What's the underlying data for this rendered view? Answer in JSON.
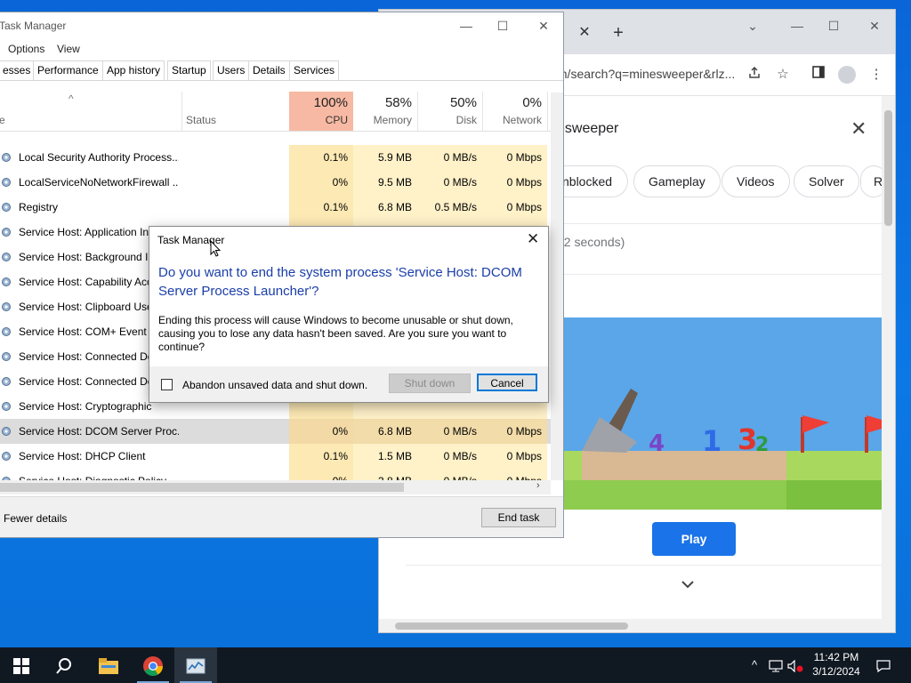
{
  "chrome": {
    "tab_close": "✕",
    "new_tab": "+",
    "window_controls": [
      "⌄",
      "—",
      "☐",
      "✕"
    ],
    "url_text": "/m/search?q=minesweeper&rlz...",
    "search_query": "esweeper",
    "chips": [
      "nblocked",
      "Gameplay",
      "Videos",
      "Solver",
      "R"
    ],
    "result_stats": "32 seconds)",
    "play_label": "Play",
    "expand_icon": "chevron-down-icon",
    "brand_blue": "#1a73e8"
  },
  "task_manager": {
    "title": "Task Manager",
    "menu": [
      "Options",
      "View"
    ],
    "tabs": [
      "esses",
      "Performance",
      "App history",
      "Startup",
      "Users",
      "Details",
      "Services"
    ],
    "columns": {
      "name": "e",
      "status": "Status",
      "cpu_pct": "100%",
      "cpu": "CPU",
      "mem_pct": "58%",
      "mem": "Memory",
      "disk_pct": "50%",
      "disk": "Disk",
      "net_pct": "0%",
      "net": "Network",
      "power_initial": "P"
    },
    "rows": [
      {
        "name": "Local Security Authority Process...",
        "cpu": "0.1%",
        "mem": "5.9 MB",
        "disk": "0 MB/s",
        "net": "0 Mbps"
      },
      {
        "name": "LocalServiceNoNetworkFirewall ...",
        "cpu": "0%",
        "mem": "9.5 MB",
        "disk": "0 MB/s",
        "net": "0 Mbps"
      },
      {
        "name": "Registry",
        "cpu": "0.1%",
        "mem": "6.8 MB",
        "disk": "0.5 MB/s",
        "net": "0 Mbps"
      },
      {
        "name": "Service Host: Application Infor...",
        "cpu": "0%",
        "mem": "0.7 MB",
        "disk": "0 MB/s",
        "net": "0 Mbps"
      },
      {
        "name": "Service Host: Background In",
        "cpu": "",
        "mem": "",
        "disk": "",
        "net": ""
      },
      {
        "name": "Service Host: Capability Acc",
        "cpu": "",
        "mem": "",
        "disk": "",
        "net": ""
      },
      {
        "name": "Service Host: Clipboard User",
        "cpu": "",
        "mem": "",
        "disk": "",
        "net": ""
      },
      {
        "name": "Service Host: COM+ Event S",
        "cpu": "",
        "mem": "",
        "disk": "",
        "net": ""
      },
      {
        "name": "Service Host: Connected De",
        "cpu": "",
        "mem": "",
        "disk": "",
        "net": ""
      },
      {
        "name": "Service Host: Connected De",
        "cpu": "",
        "mem": "",
        "disk": "",
        "net": ""
      },
      {
        "name": "Service Host: Cryptographic",
        "cpu": "",
        "mem": "",
        "disk": "",
        "net": ""
      },
      {
        "name": "Service Host: DCOM Server Proc...",
        "cpu": "0%",
        "mem": "6.8 MB",
        "disk": "0 MB/s",
        "net": "0 Mbps"
      },
      {
        "name": "Service Host: DHCP Client",
        "cpu": "0.1%",
        "mem": "1.5 MB",
        "disk": "0 MB/s",
        "net": "0 Mbps"
      },
      {
        "name": "Service Host: Diagnostic Policy ...",
        "cpu": "0%",
        "mem": "3.8 MB",
        "disk": "0 MB/s",
        "net": "0 Mbps"
      }
    ],
    "fewer_details": "Fewer details",
    "end_task": "End task",
    "cpu_header_color": "#f7b9a3",
    "cpu_cell_color": "#fde9b4",
    "mem_cell_color": "#fff1c8"
  },
  "dialog": {
    "title": "Task Manager",
    "heading": "Do you want to end the system process 'Service Host: DCOM Server Process Launcher'?",
    "body": "Ending this process will cause Windows to become unusable or shut down, causing you to lose any data hasn't been saved. Are you sure you want to continue?",
    "checkbox_label": "Abandon unsaved data and shut down.",
    "shutdown_label": "Shut down",
    "cancel_label": "Cancel",
    "close": "✕"
  },
  "taskbar": {
    "time": "11:42 PM",
    "date": "3/12/2024",
    "icons": [
      "windows-start-icon",
      "search-icon",
      "file-explorer-icon",
      "chrome-icon",
      "task-manager-icon"
    ]
  }
}
